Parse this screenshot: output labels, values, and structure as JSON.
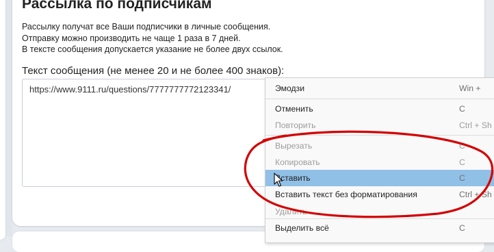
{
  "section": {
    "title": "Рассылка по подписчикам",
    "description_lines": [
      "Рассылку получат все Ваши подписчики в личные сообщения.",
      "Отправку можно производить не чаще 1 раза в 7 дней.",
      "В тексте сообщения допускается указание не более двух ссылок."
    ],
    "message_label": "Текст сообщения (не менее 20 и не более 400 знаков):",
    "message_value": "https://www.9111.ru/questions/7777777772123341/"
  },
  "context_menu": {
    "items": [
      {
        "label": "Эмодзи",
        "shortcut": "Win +",
        "disabled": false,
        "highlighted": false
      },
      {
        "label": "Отменить",
        "shortcut": "C",
        "disabled": false,
        "highlighted": false
      },
      {
        "label": "Повторить",
        "shortcut": "Ctrl + Sh",
        "disabled": true,
        "highlighted": false
      },
      {
        "label": "Вырезать",
        "shortcut": "C",
        "disabled": true,
        "highlighted": false
      },
      {
        "label": "Копировать",
        "shortcut": "C",
        "disabled": true,
        "highlighted": false
      },
      {
        "label": "Вставить",
        "shortcut": "C",
        "disabled": false,
        "highlighted": true
      },
      {
        "label": "Вставить текст без форматирования",
        "shortcut": "Ctrl + Sh",
        "disabled": false,
        "highlighted": false
      },
      {
        "label": "Удалить",
        "shortcut": "",
        "disabled": true,
        "highlighted": false
      },
      {
        "label": "Выделить всё",
        "shortcut": "C",
        "disabled": false,
        "highlighted": false
      }
    ]
  },
  "colors": {
    "page_background": "#e7ebf0",
    "menu_highlight": "#91c0e7",
    "annotation_red": "#d40000"
  }
}
